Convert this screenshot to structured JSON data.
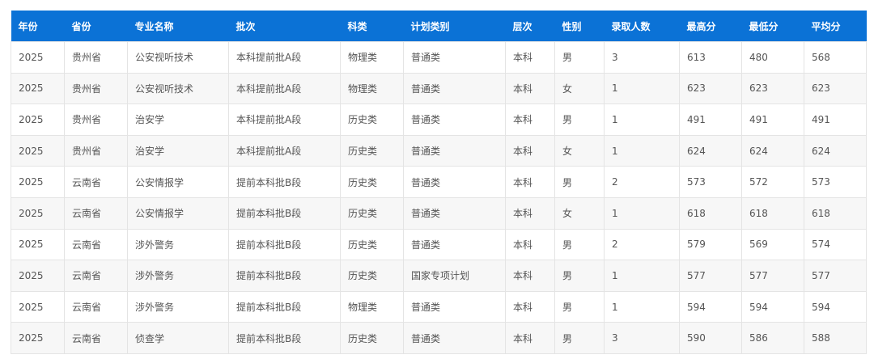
{
  "table": {
    "headers": [
      "年份",
      "省份",
      "专业名称",
      "批次",
      "科类",
      "计划类别",
      "层次",
      "性别",
      "录取人数",
      "最高分",
      "最低分",
      "平均分"
    ],
    "rows": [
      [
        "2025",
        "贵州省",
        "公安视听技术",
        "本科提前批A段",
        "物理类",
        "普通类",
        "本科",
        "男",
        "3",
        "613",
        "480",
        "568"
      ],
      [
        "2025",
        "贵州省",
        "公安视听技术",
        "本科提前批A段",
        "物理类",
        "普通类",
        "本科",
        "女",
        "1",
        "623",
        "623",
        "623"
      ],
      [
        "2025",
        "贵州省",
        "治安学",
        "本科提前批A段",
        "历史类",
        "普通类",
        "本科",
        "男",
        "1",
        "491",
        "491",
        "491"
      ],
      [
        "2025",
        "贵州省",
        "治安学",
        "本科提前批A段",
        "历史类",
        "普通类",
        "本科",
        "女",
        "1",
        "624",
        "624",
        "624"
      ],
      [
        "2025",
        "云南省",
        "公安情报学",
        "提前本科批B段",
        "历史类",
        "普通类",
        "本科",
        "男",
        "2",
        "573",
        "572",
        "573"
      ],
      [
        "2025",
        "云南省",
        "公安情报学",
        "提前本科批B段",
        "历史类",
        "普通类",
        "本科",
        "女",
        "1",
        "618",
        "618",
        "618"
      ],
      [
        "2025",
        "云南省",
        "涉外警务",
        "提前本科批B段",
        "历史类",
        "普通类",
        "本科",
        "男",
        "2",
        "579",
        "569",
        "574"
      ],
      [
        "2025",
        "云南省",
        "涉外警务",
        "提前本科批B段",
        "历史类",
        "国家专项计划",
        "本科",
        "男",
        "1",
        "577",
        "577",
        "577"
      ],
      [
        "2025",
        "云南省",
        "涉外警务",
        "提前本科批B段",
        "物理类",
        "普通类",
        "本科",
        "男",
        "1",
        "594",
        "594",
        "594"
      ],
      [
        "2025",
        "云南省",
        "侦查学",
        "提前本科批B段",
        "历史类",
        "普通类",
        "本科",
        "男",
        "3",
        "590",
        "586",
        "588"
      ]
    ]
  }
}
